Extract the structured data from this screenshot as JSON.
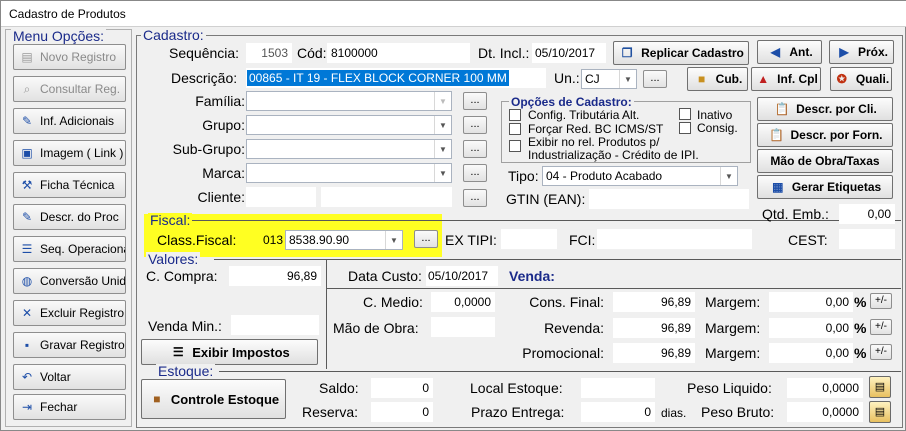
{
  "window": {
    "title": "Cadastro de Produtos"
  },
  "menu": {
    "title": "Menu Opções:",
    "items": [
      {
        "label": "Novo Registro",
        "icon": "new-record-icon",
        "glyph": "▤",
        "disabled": true
      },
      {
        "label": "Consultar Reg.",
        "icon": "binoculars-icon",
        "glyph": "⌕",
        "disabled": true
      },
      {
        "label": "Inf. Adicionais",
        "icon": "pencil-note-icon",
        "glyph": "✎",
        "disabled": false
      },
      {
        "label": "Imagem ( Link )",
        "icon": "image-icon",
        "glyph": "▣",
        "disabled": false
      },
      {
        "label": "Ficha Técnica",
        "icon": "tools-icon",
        "glyph": "⚒",
        "disabled": false
      },
      {
        "label": "Descr. do Proc",
        "icon": "pencil-note-icon",
        "glyph": "✎",
        "disabled": false
      },
      {
        "label": "Seq. Operacional",
        "icon": "list-doc-icon",
        "glyph": "☰",
        "disabled": false
      },
      {
        "label": "Conversão Unid.",
        "icon": "globe-icon",
        "glyph": "◍",
        "disabled": false
      },
      {
        "label": "Excluir Registro",
        "icon": "delete-x-icon",
        "glyph": "✕",
        "disabled": false
      },
      {
        "label": "Gravar Registro",
        "icon": "save-icon",
        "glyph": "▪",
        "disabled": false
      },
      {
        "label": "Voltar",
        "icon": "undo-icon",
        "glyph": "↶",
        "disabled": false
      },
      {
        "label": "Fechar",
        "icon": "exit-door-icon",
        "glyph": "⇥",
        "disabled": false
      }
    ]
  },
  "cadastro": {
    "title": "Cadastro:",
    "sequencia_label": "Sequência:",
    "sequencia": "1503",
    "cod_label": "Cód:",
    "cod": "8100000",
    "dt_incl_label": "Dt. Incl.:",
    "dt_incl": "05/10/2017",
    "descricao_label": "Descrição:",
    "descricao": "00865 - IT 19 - FLEX BLOCK CORNER 100 MM",
    "un_label": "Un.:",
    "un": "CJ",
    "familia_label": "Família:",
    "grupo_label": "Grupo:",
    "subgrupo_label": "Sub-Grupo:",
    "marca_label": "Marca:",
    "cliente_label": "Cliente:",
    "tipo_label": "Tipo:",
    "tipo": "04 - Produto Acabado",
    "gtin_label": "GTIN (EAN):",
    "opcoes_title": "Opções de Cadastro:",
    "opt_tributaria": "Config. Tributária Alt.",
    "opt_forcar": "Forçar Red. BC ICMS/ST",
    "opt_inativo": "Inativo",
    "opt_consig": "Consig.",
    "opt_exibir_1": "Exibir no rel. Produtos p/",
    "opt_exibir_2": "Industrialização - Crédito de IPI.",
    "dots": "..."
  },
  "buttons": {
    "replicar": "Replicar Cadastro",
    "ant": "Ant.",
    "prox": "Próx.",
    "cub": "Cub.",
    "inf_cpl": "Inf. Cpl",
    "quali": "Quali.",
    "descr_cli": "Descr. por Cli.",
    "descr_forn": "Descr. por Forn.",
    "mao_obra_taxas": "Mão de Obra/Taxas",
    "gerar_etiquetas": "Gerar Etiquetas"
  },
  "fiscal": {
    "title": "Fiscal:",
    "class_label": "Class.Fiscal:",
    "class_prefix": "013",
    "class_value": "8538.90.90",
    "ex_tipi_label": "EX TIPI:",
    "fci_label": "FCI:",
    "cest_label": "CEST:",
    "qtd_emb_label": "Qtd. Emb.:",
    "qtd_emb": "0,00"
  },
  "valores": {
    "title": "Valores:",
    "c_compra_label": "C. Compra:",
    "c_compra": "96,89",
    "venda_min_label": "Venda Min.:",
    "exibir_impostos": "Exibir Impostos",
    "data_custo_label": "Data Custo:",
    "data_custo": "05/10/2017",
    "venda_title": "Venda:",
    "c_medio_label": "C. Medio:",
    "c_medio": "0,0000",
    "mao_obra_label": "Mão de Obra:",
    "cons_final_label": "Cons. Final:",
    "cons_final": "96,89",
    "revenda_label": "Revenda:",
    "revenda": "96,89",
    "promocional_label": "Promocional:",
    "promocional": "96,89",
    "margem_label": "Margem:",
    "margem_values": [
      "0,00",
      "0,00",
      "0,00"
    ],
    "pct": "%",
    "plusminus": "+/-"
  },
  "estoque": {
    "title": "Estoque:",
    "controle": "Controle Estoque",
    "saldo_label": "Saldo:",
    "saldo": "0",
    "reserva_label": "Reserva:",
    "reserva": "0",
    "local_label": "Local Estoque:",
    "prazo_label": "Prazo Entrega:",
    "prazo": "0",
    "dias": "dias.",
    "peso_liq_label": "Peso Liquido:",
    "peso_liq": "0,0000",
    "peso_bruto_label": "Peso Bruto:",
    "peso_bruto": "0,0000"
  },
  "colors": {
    "highlight": "#ffff22",
    "selection": "#0078d7",
    "section_title": "#1a2a8a"
  }
}
